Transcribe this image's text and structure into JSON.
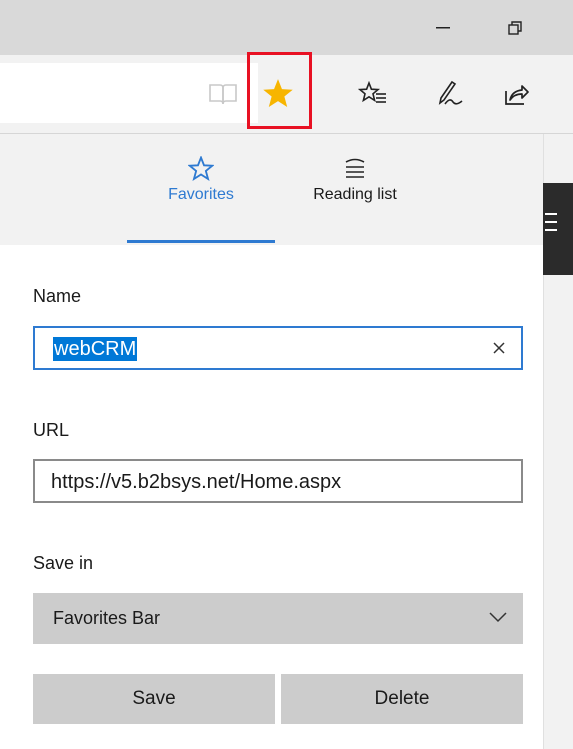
{
  "window": {
    "controls": [
      {
        "name": "minimize-icon",
        "glyph": "—"
      },
      {
        "name": "restore-icon",
        "glyph": "❐"
      }
    ]
  },
  "toolbar": {
    "icons": [
      "reading-view-icon",
      "favorite-star-icon",
      "hub-icon",
      "web-note-icon",
      "share-icon"
    ],
    "accent_star_color": "#f7b500"
  },
  "hub": {
    "tabs": [
      {
        "label": "Favorites",
        "icon": "star-outline-icon",
        "active": true
      },
      {
        "label": "Reading list",
        "icon": "reading-list-icon",
        "active": false
      }
    ],
    "accent_color": "#2e7ad1"
  },
  "form": {
    "name_label": "Name",
    "name_value": "webCRM",
    "url_label": "URL",
    "url_value": "https://v5.b2bsys.net/Home.aspx",
    "save_in_label": "Save in",
    "save_in_value": "Favorites Bar",
    "save_button": "Save",
    "delete_button": "Delete"
  }
}
